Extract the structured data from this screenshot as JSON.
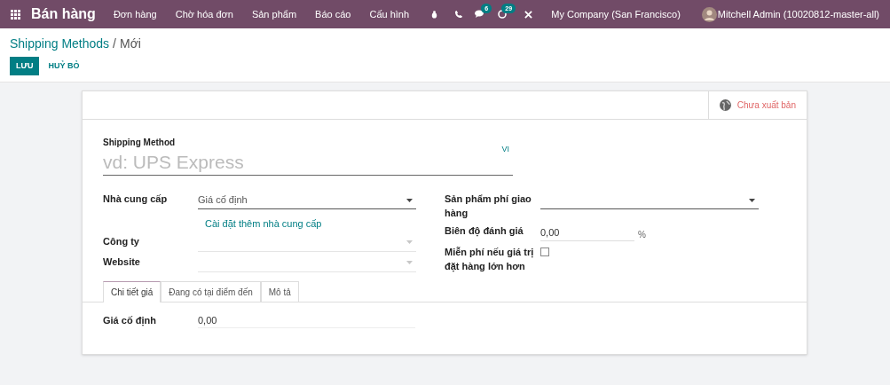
{
  "navbar": {
    "app_name": "Bán hàng",
    "menu": [
      "Đơn hàng",
      "Chờ hóa đơn",
      "Sản phẩm",
      "Báo cáo",
      "Cấu hình"
    ],
    "messages_badge": "6",
    "activities_badge": "29",
    "company": "My Company (San Francisco)",
    "user": "Mitchell Admin (10020812-master-all)"
  },
  "breadcrumb": {
    "parent": "Shipping Methods",
    "separator": "/",
    "current": "Mới"
  },
  "buttons": {
    "save": "LƯU",
    "discard": "HUỶ BỎ"
  },
  "publish_status": "Chưa xuất bản",
  "name_field": {
    "label": "Shipping Method",
    "placeholder": "vd: UPS Express",
    "language": "VI"
  },
  "left_fields": [
    {
      "kind": "select",
      "label": "Nhà cung cấp",
      "value": "Giá cố định",
      "link": "Cài đặt thêm nhà cung cấp"
    },
    {
      "kind": "select_disabled",
      "label": "Công ty"
    },
    {
      "kind": "select_disabled",
      "label": "Website"
    }
  ],
  "right_fields": [
    {
      "kind": "select",
      "label": "Sản phẩm phí giao hàng"
    },
    {
      "kind": "number",
      "label": "Biên độ đánh giá",
      "value": "0,00",
      "suffix": "%"
    },
    {
      "kind": "checkbox",
      "label": "Miễn phí nếu giá trị đặt hàng lớn hơn",
      "checked": false
    }
  ],
  "tabs": [
    {
      "label": "Chi tiết giá",
      "selected": true
    },
    {
      "label": "Đang có tại điểm đến",
      "selected": false
    },
    {
      "label": "Mô tả",
      "selected": false
    }
  ],
  "tab_fields": [
    {
      "label": "Giá cố định",
      "value": "0,00"
    }
  ]
}
